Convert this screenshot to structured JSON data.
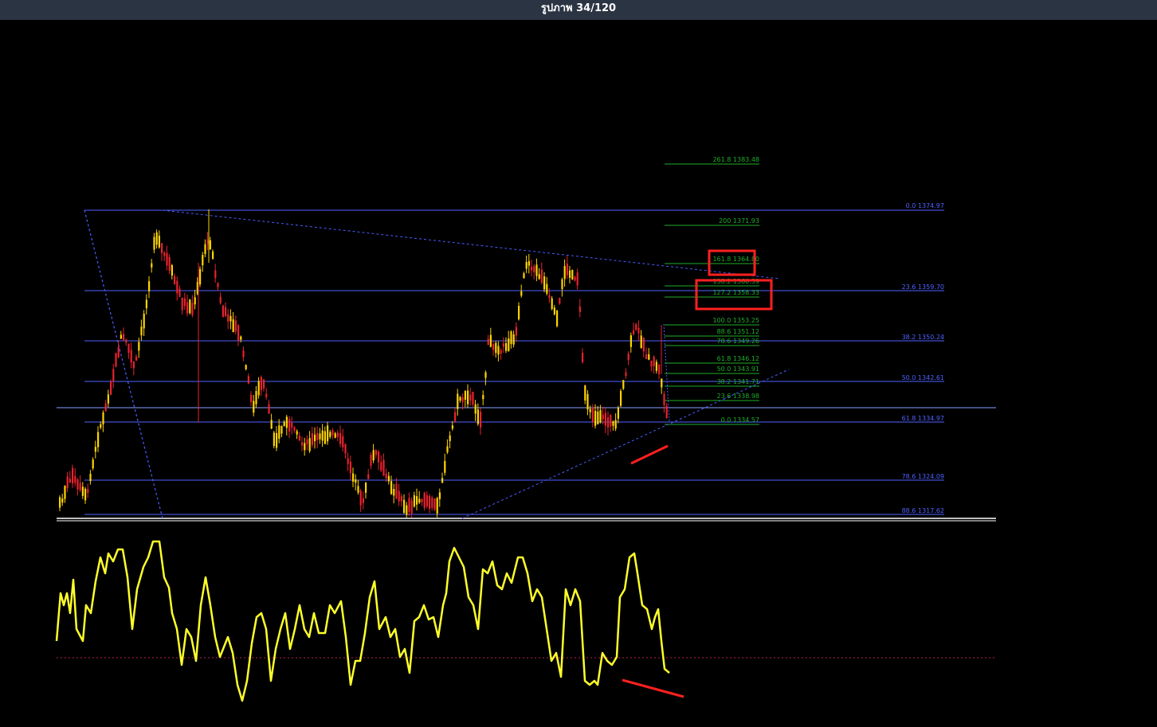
{
  "title": "รูปภาพ 34/120",
  "colors": {
    "background": "#000000",
    "topbar": "#2b3442",
    "bull_candle": "#ffd500",
    "bear_candle": "#e8222e",
    "retracement": "#4f62ff",
    "extension": "#1fae2a",
    "trendline": "#4a5cff",
    "oscillator": "#ffff2a",
    "annotation": "#ff2020"
  },
  "retracement_levels": [
    {
      "text": "0.0 1374.97"
    },
    {
      "text": "23.6 1359.70"
    },
    {
      "text": "38.2 1350.24"
    },
    {
      "text": "50.0 1342.61"
    },
    {
      "text": "61.8 1334.97"
    },
    {
      "text": "78.6 1324.09"
    },
    {
      "text": "88.6 1317.62"
    }
  ],
  "extension_levels": [
    {
      "text": "261.8 1383.48"
    },
    {
      "text": "200 1371.93"
    },
    {
      "text": "161.8 1364.80"
    },
    {
      "text": "138.2 1360.39"
    },
    {
      "text": "127.2 1358.33"
    },
    {
      "text": "100.0 1353.25"
    },
    {
      "text": "88.6 1351.12"
    },
    {
      "text": "78.6 1349.26"
    },
    {
      "text": "61.8 1346.12"
    },
    {
      "text": "50.0 1343.91"
    },
    {
      "text": "38.2 1341.71"
    },
    {
      "text": "23.6 1338.98"
    },
    {
      "text": "0.0 1334.57"
    }
  ]
}
